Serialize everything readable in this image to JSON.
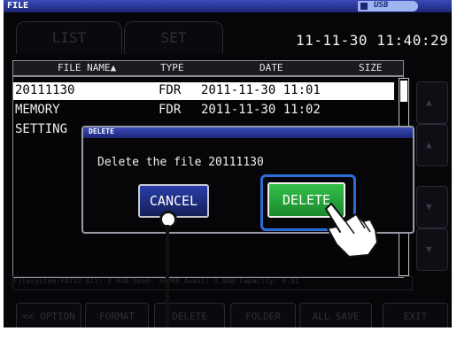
{
  "title_bar": {
    "label": "FILE",
    "usb_label": "USB"
  },
  "tabs": [
    {
      "label": "LIST"
    },
    {
      "label": "SET"
    }
  ],
  "datetime": "11-11-30 11:40:29",
  "columns": {
    "file_name": "FILE NAME▲",
    "type": "TYPE",
    "date": "DATE",
    "size": "SIZE"
  },
  "rows": [
    {
      "name": "20111130",
      "type": "FDR",
      "date": "2011-11-30 11:01"
    },
    {
      "name": "MEMORY",
      "type": "FDR",
      "date": "2011-11-30 11:02"
    },
    {
      "name": "SETTING",
      "type": "",
      "date": ""
    }
  ],
  "status_line": "Filesystem:FAT32 All: 3.9GB Used: 392KB Avail: 3.0GB Capacity: 0.01",
  "bottom_buttons": [
    "<< OPTION",
    "FORMAT",
    "DELETE",
    "FOLDER",
    "ALL SAVE",
    "EXIT"
  ],
  "dialog": {
    "title": "DELETE",
    "message": "Delete the file  20111130",
    "cancel_label": "CANCEL",
    "delete_label": "DELETE"
  },
  "colors": {
    "title_bar": "#2a38a0",
    "delete_button": "#22a83a",
    "cancel_button": "#1f2f8a",
    "highlight_ring": "#2e6cd8"
  }
}
